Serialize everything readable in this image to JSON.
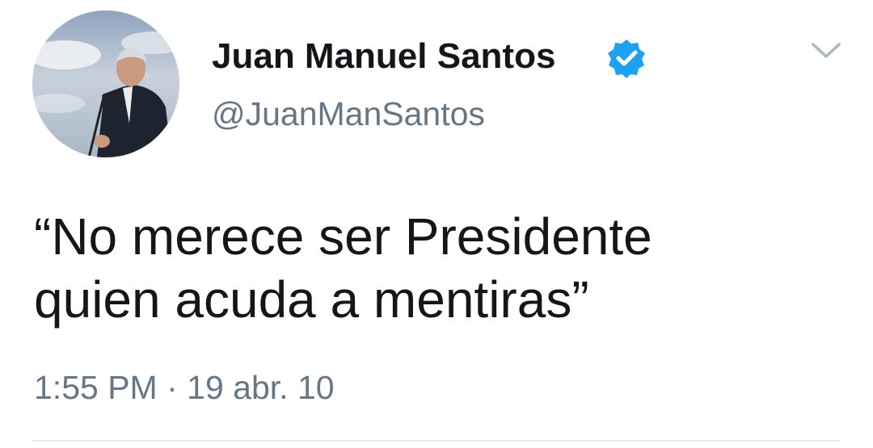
{
  "tweet": {
    "author": {
      "display_name": "Juan Manuel Santos",
      "handle": "@JuanManSantos",
      "verified_icon": "verified-badge-icon",
      "avatar": "profile-photo"
    },
    "text_lines": [
      "“No merece ser Presidente",
      "quien acuda a mentiras”"
    ],
    "time": "1:55 PM",
    "separator": "·",
    "date": "19 abr. 10",
    "menu_icon": "chevron-down-icon"
  },
  "colors": {
    "text": "#14171a",
    "secondary_text": "#657786",
    "verified_blue": "#1da1f2",
    "divider": "#e1e8ed"
  }
}
